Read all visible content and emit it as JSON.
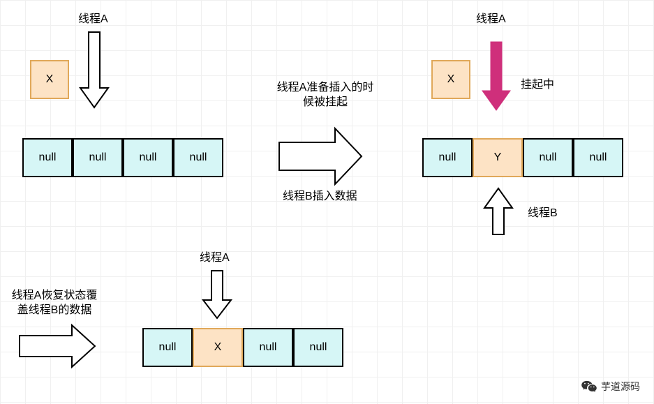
{
  "labels": {
    "threadA1": "线程A",
    "threadA2": "线程A",
    "threadA3": "线程A",
    "threadB": "线程B",
    "suspended": "挂起中",
    "arrowMiddleTop": "线程A准备插入的时候被挂起",
    "arrowMiddleBottom": "线程B插入数据",
    "bottomLeft": "线程A恢复状态覆盖线程B的数据",
    "watermark": "芋道源码"
  },
  "boxes": {
    "row1": {
      "x": "X",
      "cells": [
        "null",
        "null",
        "null",
        "null"
      ]
    },
    "row2": {
      "x": "X",
      "cells": [
        "null",
        "Y",
        "null",
        "null"
      ]
    },
    "row3": {
      "cells": [
        "null",
        "X",
        "null",
        "null"
      ]
    }
  }
}
